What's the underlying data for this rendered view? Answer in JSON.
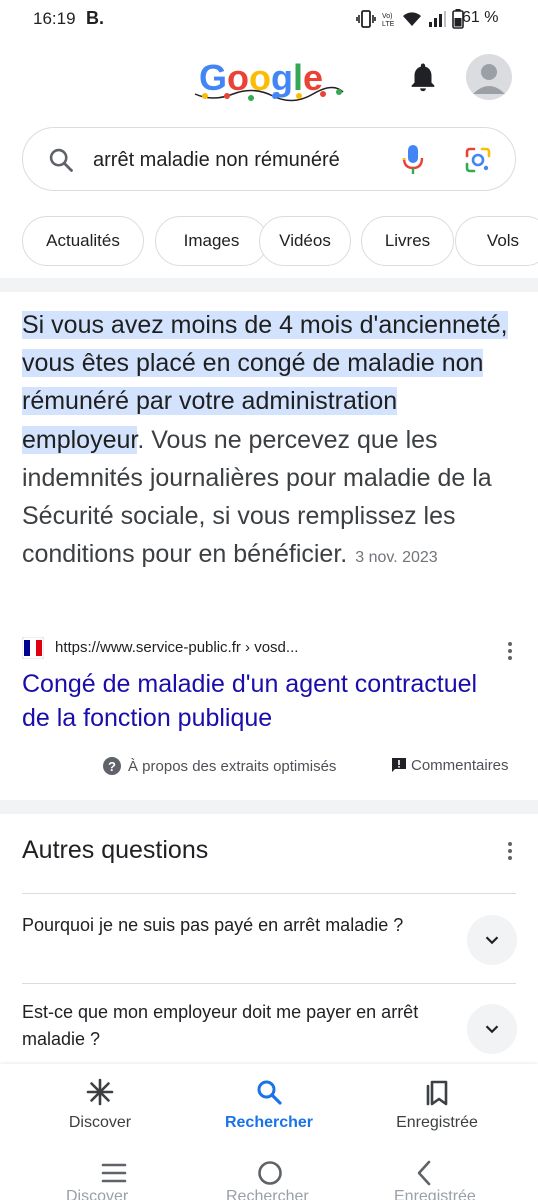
{
  "status_bar": {
    "time": "16:19",
    "app_badge": "B.",
    "network": "Vo) LTE",
    "battery_pct": "61 %"
  },
  "header": {
    "logo_text": "Google",
    "icons": [
      "notification-bell-icon",
      "account-avatar-icon"
    ]
  },
  "search": {
    "query": "arrêt maladie non rémunéré",
    "icons": [
      "search-icon",
      "mic-icon",
      "google-lens-icon"
    ]
  },
  "chips": [
    "Actualités",
    "Images",
    "Vidéos",
    "Livres",
    "Vols"
  ],
  "featured_snippet": {
    "highlighted_text": "Si vous avez moins de 4 mois d'ancienneté, vous êtes placé en congé de maladie non rémunéré par votre administration employeur",
    "rest_text": ". Vous ne percevez que les indemnités journalières pour maladie de la Sécurité sociale, si vous remplissez les conditions pour en bénéficier.",
    "date": "3 nov. 2023",
    "source_url": "https://www.service-public.fr › vosd...",
    "link_title": "Congé de maladie d'un agent contractuel de la fonction publique",
    "about_label": "À propos des extraits optimisés",
    "comments_label": "Commentaires"
  },
  "people_also_ask": {
    "title": "Autres questions",
    "questions": [
      "Pourquoi je ne suis pas payé en arrêt maladie ?",
      "Est-ce que mon employeur doit me payer en arrêt maladie ?"
    ]
  },
  "bottom_nav": {
    "items": [
      {
        "label": "Discover",
        "icon": "asterisk-icon"
      },
      {
        "label": "Rechercher",
        "icon": "search-icon"
      },
      {
        "label": "Enregistrée",
        "icon": "bookmarks-icon"
      }
    ],
    "active_index": 1
  },
  "system_nav": {
    "icons": [
      "recents-icon",
      "home-icon",
      "back-icon"
    ]
  },
  "colors": {
    "link": "#1a0dab",
    "highlight": "#d3e3fd",
    "accent": "#1a73e8"
  }
}
